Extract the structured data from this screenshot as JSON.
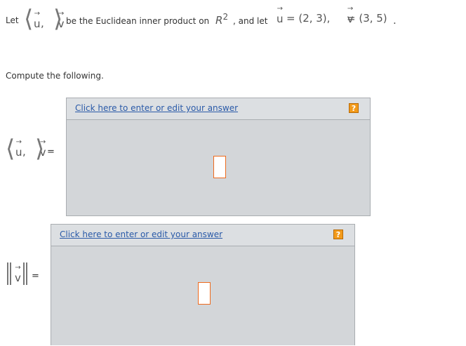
{
  "intro": {
    "let": "Let",
    "u_sym": "u",
    "v_sym": "v",
    "middle": "be the Euclidean inner product on",
    "space": "R",
    "space_exp": "2",
    "and_let": ", and let",
    "u_def": "= (2, 3),",
    "v_def": "= (3, 5)",
    "period": "."
  },
  "compute": "Compute the following.",
  "questions": [
    {
      "u_sym": "u",
      "v_sym": "v",
      "equals": "=",
      "link": "Click here to enter or edit your answer",
      "help": "?"
    },
    {
      "v_sym": "v",
      "equals": "=",
      "link": "Click here to enter or edit your answer",
      "help": "?"
    }
  ],
  "colors": {
    "link": "#2a5aa8",
    "help_bg": "#f29a1a",
    "answer_border": "#ee6a1d",
    "panel_bg": "#d3d6d9"
  }
}
